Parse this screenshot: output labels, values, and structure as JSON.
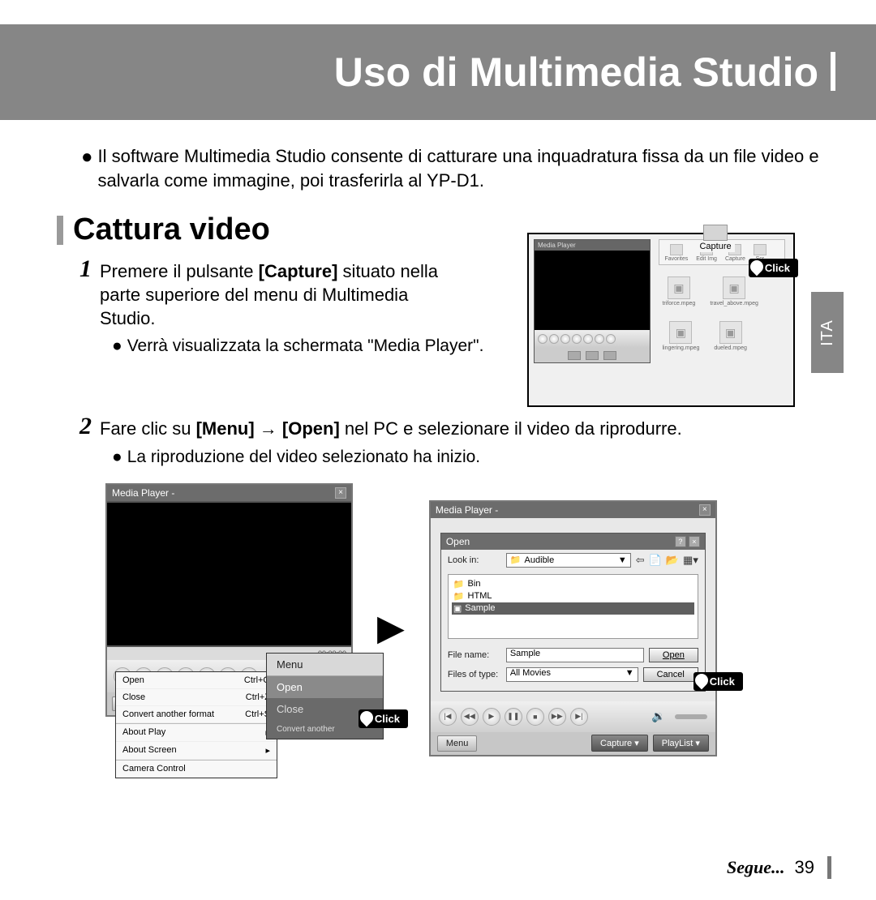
{
  "header": {
    "title": "Uso di Multimedia Studio"
  },
  "intro": "Il software Multimedia Studio consente di catturare una inquadratura fissa da un file video e salvarla come immagine, poi trasferirla al YP-D1.",
  "section": {
    "title": "Cattura video"
  },
  "side_tab": "ITA",
  "step1": {
    "num": "1",
    "text_prefix": "Premere il pulsante ",
    "bold1": "[Capture]",
    "text_rest": " situato nella parte superiore del menu di Multimedia Studio.",
    "bullet": "Verrà visualizzata la schermata \"Media Player\"."
  },
  "step2": {
    "num": "2",
    "text_prefix": "Fare clic su ",
    "bold1": "[Menu]",
    "arrow": " → ",
    "bold2": "[Open]",
    "text_rest": " nel PC e selezionare il video da riprodurre.",
    "bullet": "La riproduzione del video selezionato ha inizio."
  },
  "fig1": {
    "mp_title": "Media Player",
    "cap_label": "Capture",
    "tb": [
      "Favorites",
      "Edit Img",
      "Capture",
      "Scr"
    ],
    "thumbs": [
      "triforce.mpeg",
      "travel_above.mpeg",
      "lingering.mpeg",
      "dueled.mpeg"
    ],
    "click": "Click"
  },
  "figA": {
    "title": "Media Player -",
    "time": "00:00:00",
    "menu_btn": "Menu",
    "overlay": {
      "a": "Menu",
      "b": "Open",
      "c": "Close",
      "d": "Convert another"
    },
    "dropdown": {
      "open": "Open",
      "open_sc": "Ctrl+O",
      "close": "Close",
      "close_sc": "Ctrl+Z",
      "convert": "Convert another format",
      "convert_sc": "Ctrl+S",
      "about_play": "About Play",
      "about_screen": "About Screen",
      "camera": "Camera Control"
    },
    "click": "Click"
  },
  "figB": {
    "title": "Media Player -",
    "open": {
      "title": "Open",
      "lookin_label": "Look in:",
      "lookin_value": "Audible",
      "items": [
        "Bin",
        "HTML",
        "Sample"
      ],
      "filename_label": "File name:",
      "filename_value": "Sample",
      "filetype_label": "Files of type:",
      "filetype_value": "All Movies",
      "open_btn": "Open",
      "cancel_btn": "Cancel"
    },
    "bottom": {
      "menu": "Menu",
      "capture": "Capture",
      "playlist": "PlayList"
    },
    "click": "Click"
  },
  "footer": {
    "segue": "Segue...",
    "page": "39"
  }
}
